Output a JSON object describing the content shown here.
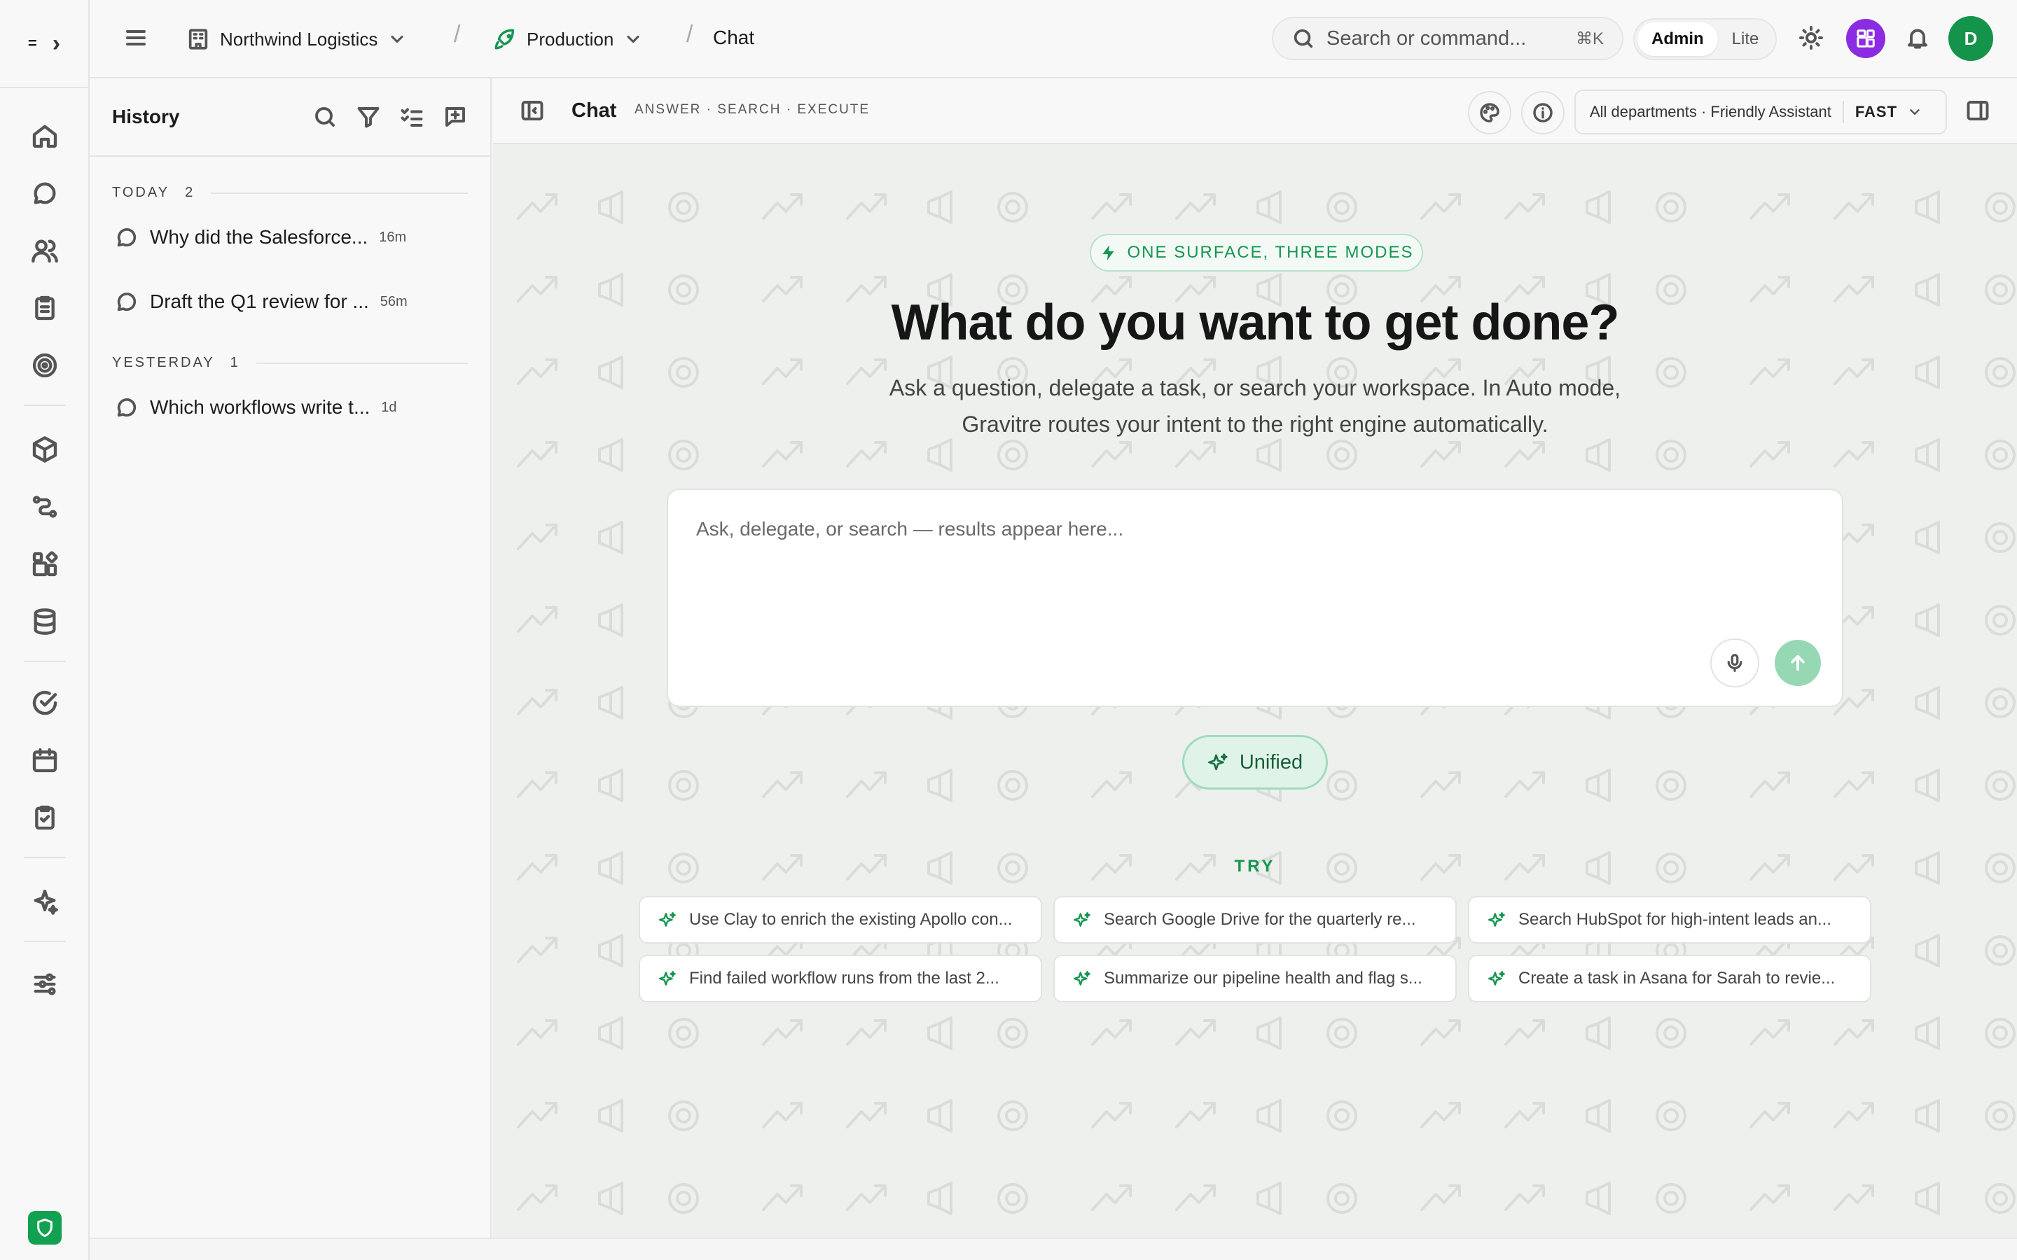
{
  "rail": {
    "logo_glyph": "=",
    "expand_glyph": "›"
  },
  "topbar": {
    "org_name": "Northwind Logistics",
    "env_name": "Production",
    "page_title": "Chat",
    "separator": "/",
    "search_placeholder": "Search or command...",
    "search_shortcut": "⌘K",
    "mode_options": [
      "Admin",
      "Lite"
    ],
    "mode_selected": "Admin",
    "avatar_initial": "D",
    "accent_color": "#13944a",
    "apps_color": "#8b2be2"
  },
  "history": {
    "title": "History",
    "groups": [
      {
        "label": "TODAY",
        "count": "2",
        "items": [
          {
            "title": "Why did the Salesforce...",
            "time": "16m"
          },
          {
            "title": "Draft the Q1 review for ...",
            "time": "56m"
          }
        ]
      },
      {
        "label": "YESTERDAY",
        "count": "1",
        "items": [
          {
            "title": "Which workflows write t...",
            "time": "1d"
          }
        ]
      }
    ]
  },
  "chatbar": {
    "title": "Chat",
    "subtitle": "ANSWER · SEARCH · EXECUTE",
    "scope_label": "All departments · Friendly Assistant",
    "speed_label": "FAST"
  },
  "hero": {
    "tag": "ONE SURFACE, THREE MODES",
    "headline": "What do you want to get done?",
    "line1": "Ask a question, delegate a task, or search your workspace. In Auto mode,",
    "line2": "Gravitre routes your intent to the right engine automatically."
  },
  "composer": {
    "placeholder": "Ask, delegate, or search — results appear here..."
  },
  "mode_pill": {
    "label": "Unified"
  },
  "try": {
    "label": "TRY",
    "suggestions": [
      "Use Clay to enrich the existing Apollo con...",
      "Search Google Drive for the quarterly re...",
      "Search HubSpot for high-intent leads an...",
      "Find failed workflow runs from the last 2...",
      "Summarize our pipeline health and flag s...",
      "Create a task in Asana for Sarah to revie..."
    ]
  }
}
